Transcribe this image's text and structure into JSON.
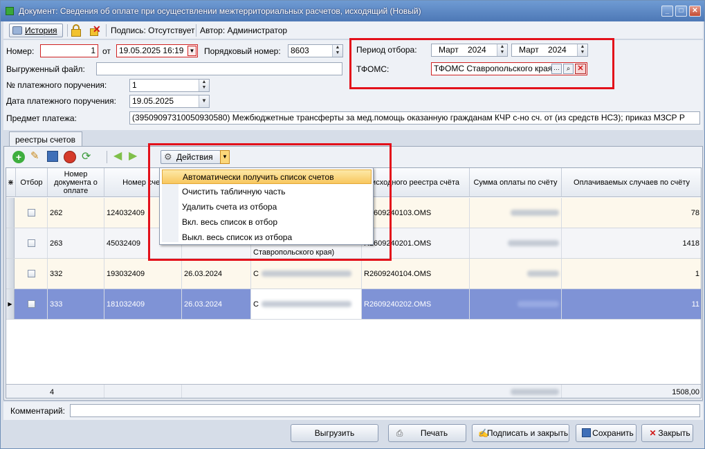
{
  "window": {
    "title": "Документ: Сведения об оплате при осуществлении межтерриториальных расчетов, исходящий (Новый)",
    "minimize": "_",
    "maximize": "□",
    "close": "✕"
  },
  "toolbar": {
    "history_label": "История",
    "signature_text": "Подпись: Отсутствует",
    "author_text": "Автор: Администратор"
  },
  "form": {
    "number_label": "Номер:",
    "number_value": "1",
    "from_label": "от",
    "date_value": "19.05.2025 16:19",
    "ordinal_label": "Порядковый номер:",
    "ordinal_value": "8603",
    "uploaded_file_label": "Выгруженный файл:",
    "uploaded_file_value": "",
    "payment_order_num_label": "№ платежного поручения:",
    "payment_order_num_value": "1",
    "payment_order_date_label": "Дата платежного поручения:",
    "payment_order_date_value": "19.05.2025",
    "subject_label": "Предмет платежа:",
    "subject_value": "(39509097310050930580) Межбюджетные трансферты за мед.помощь оказанную гражданам КЧР с-но сч. от (из средств НСЗ); приказ МЗСР Р",
    "period_label": "Период отбора:",
    "period_from_month": "Март",
    "period_from_year": "2024",
    "period_to_month": "Март",
    "period_to_year": "2024",
    "tfoms_label": "ТФОМС:",
    "tfoms_value": "ТФОМС Ставропольского края"
  },
  "tabs": [
    {
      "label": "реестры счетов"
    }
  ],
  "panel_toolbar": {
    "actions_label": "Действия"
  },
  "grid": {
    "columns": [
      {
        "label": "Отбор"
      },
      {
        "label": "Номер документа о оплате"
      },
      {
        "label": "Номер счет"
      },
      {
        "label": ""
      },
      {
        "label": ""
      },
      {
        "label": "исходного реестра счёта"
      },
      {
        "label": "Сумма оплаты по счёту"
      },
      {
        "label": "Оплачиваемых случаев по счёту"
      }
    ],
    "rows": [
      {
        "doc_num": "262",
        "invoice_num": "124032409",
        "date": "",
        "desc": "",
        "registry": "R2609240103.OMS",
        "cases": "78"
      },
      {
        "doc_num": "263",
        "invoice_num": "45032409",
        "date": "",
        "desc": "Ставропольского края)",
        "registry": "R2609240201.OMS",
        "cases": "1418"
      },
      {
        "doc_num": "332",
        "invoice_num": "193032409",
        "date": "26.03.2024",
        "desc": "С",
        "registry": "R2609240104.OMS",
        "cases": "1"
      },
      {
        "doc_num": "333",
        "invoice_num": "181032409",
        "date": "26.03.2024",
        "desc": "С",
        "registry": "R2609240202.OMS",
        "cases": "11"
      }
    ],
    "footer_count": "4",
    "footer_total": "1508,00"
  },
  "actions_menu": {
    "items": [
      {
        "label": "Автоматически получить список счетов"
      },
      {
        "label": "Очистить табличную часть"
      },
      {
        "label": "Удалить счета из отбора"
      },
      {
        "label": "Вкл. весь список в отбор"
      },
      {
        "label": "Выкл. весь список из отбора"
      }
    ]
  },
  "comment": {
    "label": "Комментарий:",
    "value": ""
  },
  "bottom_buttons": {
    "export": "Выгрузить",
    "print": "Печать",
    "sign_close": "Подписать и закрыть",
    "save": "Сохранить",
    "close": "Закрыть"
  },
  "colors": {
    "highlight": "#e3101a",
    "selected_row": "#7f93d6",
    "menu_active": "#f8c75e"
  }
}
